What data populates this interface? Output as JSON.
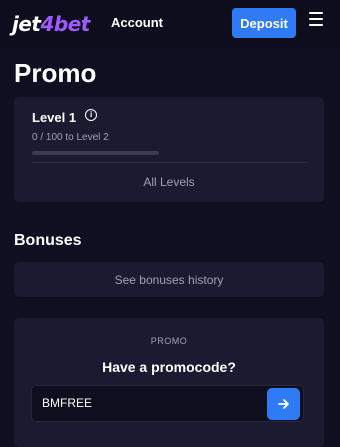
{
  "header": {
    "logo_part1": "jet",
    "logo_part2": "4bet",
    "account_label": "Account",
    "deposit_label": "Deposit",
    "menu_icon": "hamburger-icon"
  },
  "page": {
    "title": "Promo"
  },
  "level": {
    "title": "Level 1",
    "info_icon": "info-icon",
    "progress_text": "0 / 100 to Level 2",
    "progress_fraction": 0,
    "all_levels_label": "All Levels"
  },
  "bonuses": {
    "title": "Bonuses",
    "history_label": "See bonuses history"
  },
  "promo": {
    "label": "PROMO",
    "question": "Have a promocode?",
    "input_value": "BMFREE",
    "submit_icon": "arrow-right-icon"
  },
  "colors": {
    "accent": "#2f7bf5",
    "logo_purple": "#9d5bff",
    "background": "#0f0f22",
    "card": "#1a1a30"
  }
}
